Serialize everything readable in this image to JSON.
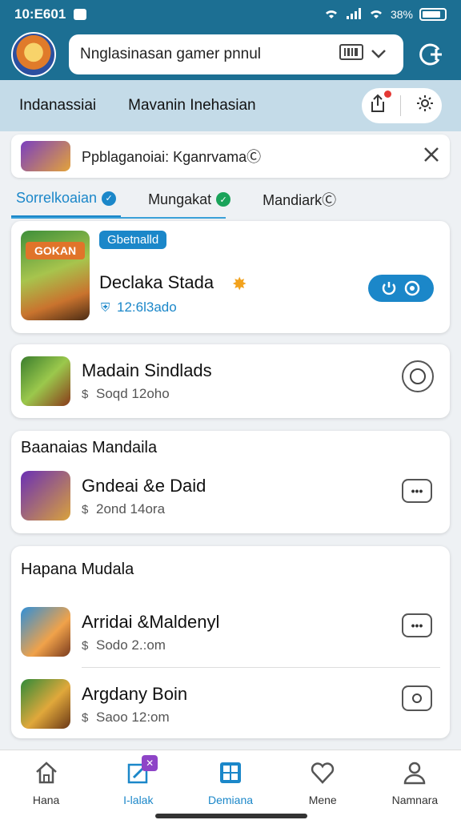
{
  "status_bar": {
    "time": "10:E601",
    "battery": "38%"
  },
  "header": {
    "search_value": "Nnglasinasan gamer pnnul"
  },
  "subnav": {
    "links": [
      "Indanassiai",
      "Mavanin Inehasian"
    ]
  },
  "promo": {
    "text": "Ppblaganoiai: KganrvamaⒸ"
  },
  "tabs": [
    {
      "label": "Sorrelkoaian"
    },
    {
      "label": "Mungakat"
    },
    {
      "label": "MandiarkⒸ"
    }
  ],
  "featured": {
    "tag": "Gbetnalld",
    "icon_text": "GOKAN",
    "name": "Declaka Stada",
    "meta": "12:6l3ado"
  },
  "apps": [
    {
      "name": "Madain Sindlads",
      "meta": "Soqd 12oho"
    }
  ],
  "sections": [
    {
      "title": "Baanaias Mandaila",
      "items": [
        {
          "name": "Gndeai &e Daid",
          "meta": "2ond 14ora"
        }
      ]
    },
    {
      "title": "Hapana Mudala",
      "items": [
        {
          "name": "Arridai &Maldenyl",
          "meta": "Sodo 2.:om"
        },
        {
          "name": "Argdany Boin",
          "meta": "Saoo 12:om"
        }
      ]
    }
  ],
  "bottom_nav": [
    {
      "label": "Hana"
    },
    {
      "label": "I-lalak"
    },
    {
      "label": "Demiana"
    },
    {
      "label": "Mene"
    },
    {
      "label": "Namnara"
    }
  ],
  "colors": {
    "primary": "#1c6f93",
    "accent": "#1b87c9",
    "subnav": "#c4dbe8"
  }
}
